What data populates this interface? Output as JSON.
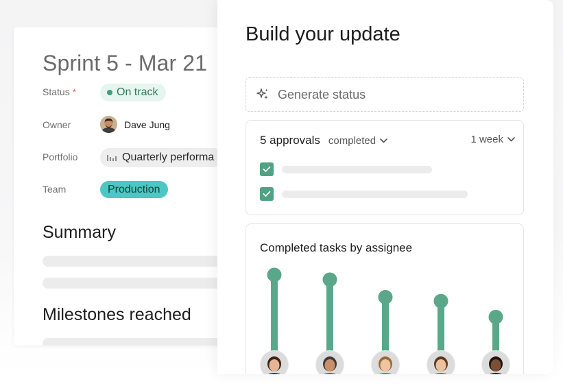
{
  "left": {
    "title": "Sprint 5 - Mar 21",
    "status": {
      "label": "Status",
      "required_mark": "*",
      "value": "On track",
      "color": "#3e9e76"
    },
    "owner": {
      "label": "Owner",
      "name": "Dave Jung"
    },
    "portfolio": {
      "label": "Portfolio",
      "value": "Quarterly performa"
    },
    "team": {
      "label": "Team",
      "value": "Production",
      "color": "#4cc7c4"
    },
    "summary_title": "Summary",
    "milestones_title": "Milestones reached"
  },
  "panel": {
    "title": "Build your update",
    "generate": {
      "label": "Generate status",
      "icon": "sparkle-icon"
    },
    "approvals": {
      "count_label": "5 approvals",
      "filter_label": "completed",
      "range_label": "1 week",
      "rows": [
        {
          "checked": true,
          "fill": 0.62
        },
        {
          "checked": true,
          "fill": 0.78
        }
      ]
    },
    "chart_data": {
      "type": "bar",
      "title": "Completed tasks by assignee",
      "categories": [
        "",
        "",
        "",
        "",
        ""
      ],
      "values": [
        100,
        94,
        72,
        67,
        47
      ],
      "ylim": [
        0,
        100
      ],
      "grid": false,
      "bar_color": "#5aa889"
    }
  }
}
